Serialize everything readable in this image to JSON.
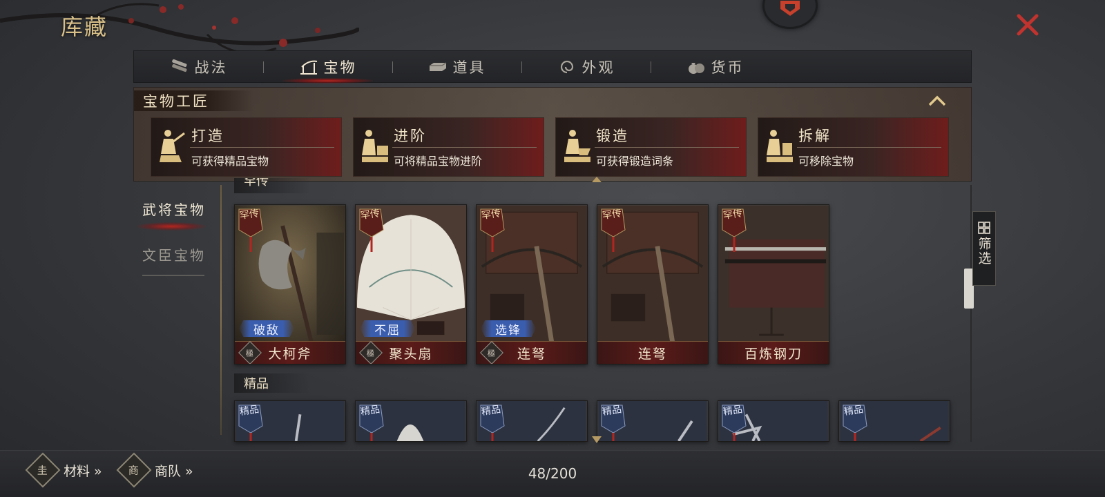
{
  "window": {
    "title": "库藏"
  },
  "tabs": [
    {
      "label": "战法",
      "icon": "scroll-bundle-icon",
      "active": false
    },
    {
      "label": "宝物",
      "icon": "bow-rack-icon",
      "active": true
    },
    {
      "label": "道具",
      "icon": "ingot-icon",
      "active": false
    },
    {
      "label": "外观",
      "icon": "swirl-icon",
      "active": false
    },
    {
      "label": "货币",
      "icon": "money-bag-icon",
      "active": false
    }
  ],
  "craft_panel": {
    "title": "宝物工匠",
    "cards": [
      {
        "name": "打造",
        "desc": "可获得精品宝物"
      },
      {
        "name": "进阶",
        "desc": "可将精品宝物进阶"
      },
      {
        "name": "锻造",
        "desc": "可获得锻造词条"
      },
      {
        "name": "拆解",
        "desc": "可移除宝物"
      }
    ]
  },
  "sidebar": {
    "items": [
      {
        "label": "武将宝物",
        "active": true
      },
      {
        "label": "文臣宝物",
        "active": false
      }
    ]
  },
  "sections": {
    "rare": {
      "label": "罕传"
    },
    "fine": {
      "label": "精品"
    }
  },
  "rare_items": [
    {
      "name": "大柯斧",
      "rarity": "罕传",
      "skill": "破敌",
      "badge": "極"
    },
    {
      "name": "聚头扇",
      "rarity": "罕传",
      "skill": "不屈",
      "badge": "極"
    },
    {
      "name": "连弩",
      "rarity": "罕传",
      "skill": "选锋",
      "badge": "極"
    },
    {
      "name": "连弩",
      "rarity": "罕传",
      "skill": "",
      "badge": ""
    },
    {
      "name": "百炼钢刀",
      "rarity": "罕传",
      "skill": "",
      "badge": ""
    }
  ],
  "fine_items": [
    {
      "rarity": "精品"
    },
    {
      "rarity": "精品"
    },
    {
      "rarity": "精品"
    },
    {
      "rarity": "精品"
    },
    {
      "rarity": "精品"
    },
    {
      "rarity": "精品"
    }
  ],
  "filter": {
    "label": "筛选"
  },
  "footer": {
    "materials": {
      "label": "材料 »",
      "emblem": "圭"
    },
    "caravan": {
      "label": "商队 »",
      "emblem": "商"
    },
    "capacity": "48/200"
  },
  "colors": {
    "accent_gold": "#d9c089",
    "accent_red": "#b3251f",
    "skill_blue": "#3b5dae",
    "close_red": "#c0332e"
  }
}
